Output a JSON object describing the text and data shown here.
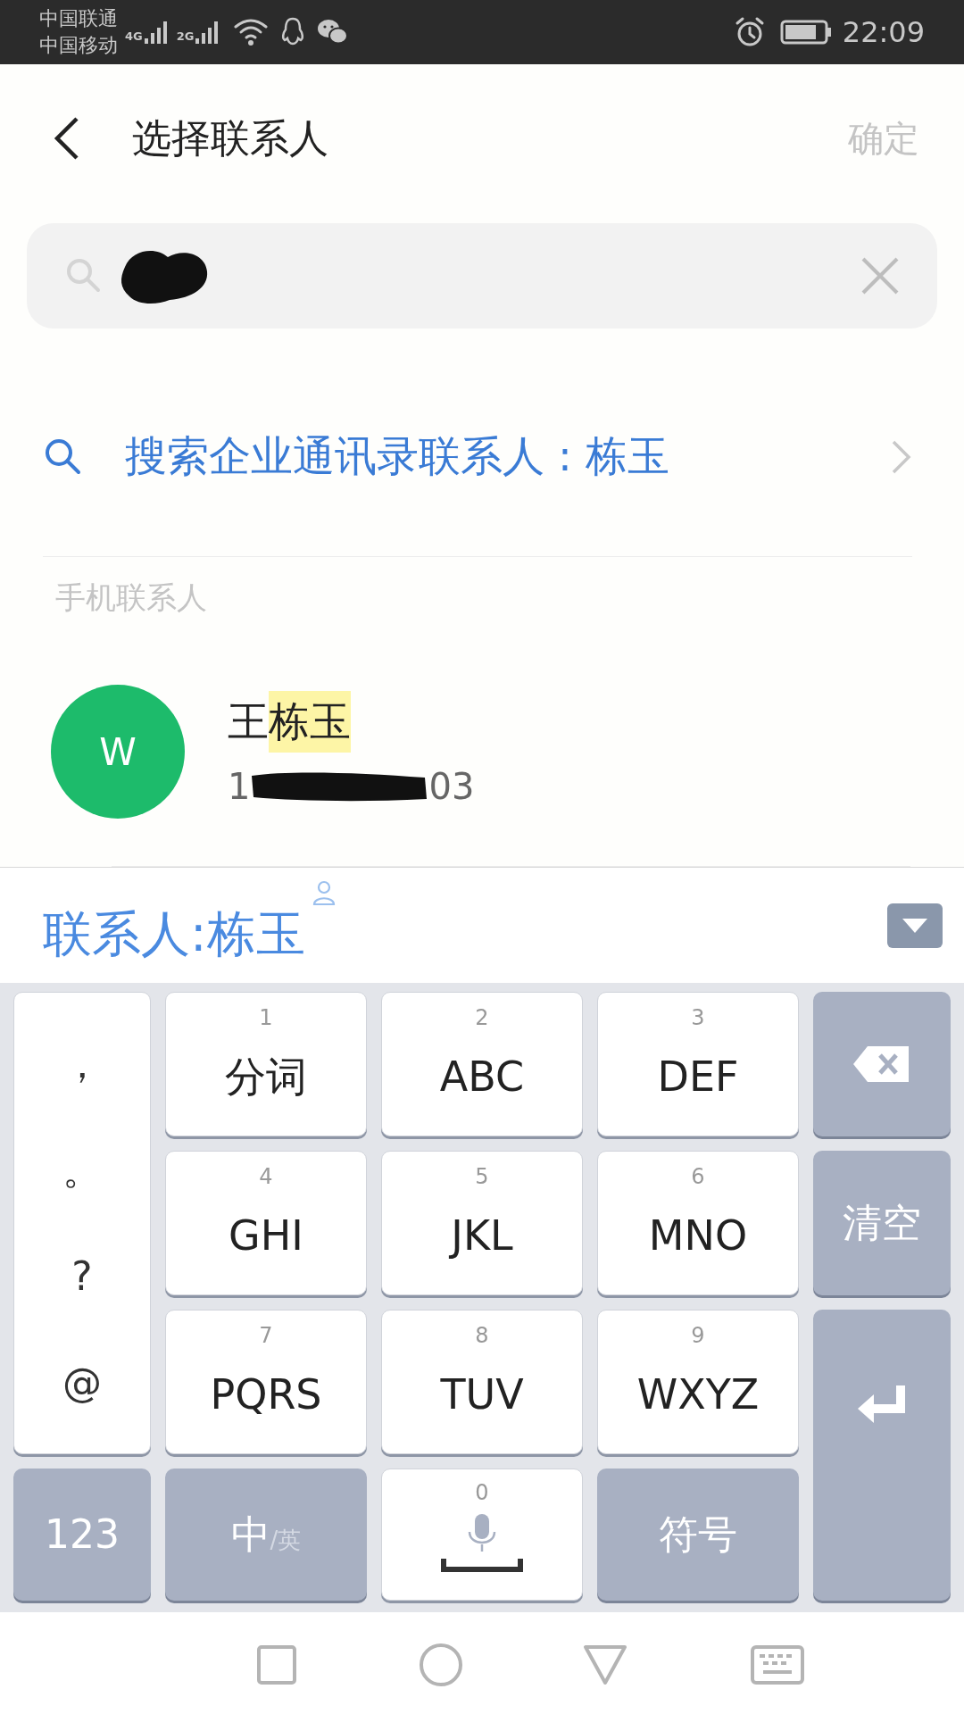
{
  "status_bar": {
    "carriers": [
      "中国联通",
      "中国移动"
    ],
    "networks": [
      "4G",
      "2G"
    ],
    "time": "22:09"
  },
  "header": {
    "title": "选择联系人",
    "confirm": "确定"
  },
  "enterprise_search": {
    "label": "搜索企业通讯录联系人 : 栋玉"
  },
  "section": {
    "title": "手机联系人"
  },
  "contacts": [
    {
      "initial": "W",
      "color": "#1dbb6b",
      "name": [
        {
          "text": "王",
          "match": false
        },
        {
          "text": "栋玉",
          "match": true
        }
      ],
      "phone_start": "1",
      "phone_end": "03"
    }
  ],
  "candidate_bar": {
    "text": "联系人:栋玉"
  },
  "keyboard": {
    "punctuation": [
      "，",
      "。",
      "?",
      "@"
    ],
    "keys": [
      {
        "digit": "1",
        "label": "分词"
      },
      {
        "digit": "2",
        "label": "ABC"
      },
      {
        "digit": "3",
        "label": "DEF"
      },
      {
        "digit": "4",
        "label": "GHI"
      },
      {
        "digit": "5",
        "label": "JKL"
      },
      {
        "digit": "6",
        "label": "MNO"
      },
      {
        "digit": "7",
        "label": "PQRS"
      },
      {
        "digit": "8",
        "label": "TUV"
      },
      {
        "digit": "9",
        "label": "WXYZ"
      }
    ],
    "clear": "清空",
    "numbers": "123",
    "lang_main": "中",
    "lang_sep": "/",
    "lang_alt": "英",
    "space_digit": "0",
    "symbols": "符号"
  }
}
